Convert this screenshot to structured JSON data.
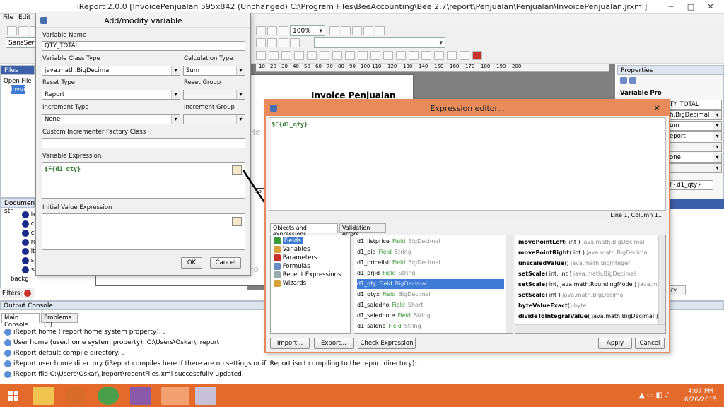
{
  "main_window": {
    "title": "iReport 2.0.0  [InvoicePenjualan 595x842 (Unchanged) C:\\Program Files\\BeeAccounting\\Bee 2.7\\report\\Penjualan\\Penjualan\\InvoicePenjualan.jrxml]",
    "menu": [
      "File",
      "Edit",
      "V"
    ],
    "font_combo": "SansSerif",
    "zoom": "100%"
  },
  "files_panel": {
    "title": "Files",
    "items": [
      "Open File",
      "Invoi"
    ]
  },
  "document_structure": {
    "title": "Document str",
    "items": [
      "te",
      "cr",
      "cr",
      "re",
      "itr",
      "sy",
      "sa"
    ],
    "footer": "backg",
    "filters_label": "Filters:"
  },
  "properties_panel": {
    "title": "Properties",
    "header": "Variable Pro",
    "values": [
      "TY_TOTAL",
      "h.BigDecimal",
      "um",
      "eport",
      "one",
      "F{d1_qty}"
    ],
    "library": "ary"
  },
  "output_console": {
    "title": "Output Console",
    "tabs": [
      "Main Console",
      "Problems (0)"
    ],
    "lines": [
      "iReport home (ireport.home system property): .",
      "User home (user.home system property): C:\\Users\\Oskar\\.ireport",
      "iReport default compile directory: .",
      "iReport user home directory (iReport compiles here if there are no settings or if iReport isn't compiling to the report directory): .",
      "iReport file C:\\Users\\Oskar\\.ireport\\recentFiles.xml successfully updated."
    ]
  },
  "report_canvas": {
    "title": "Invoice Penjualan",
    "ruler": [
      "10",
      "20",
      "30",
      "40",
      "50",
      "60",
      "70",
      "80",
      "90",
      "100",
      "110",
      "120",
      "130",
      "140",
      "150",
      "160",
      "170",
      "180",
      "190",
      "200"
    ],
    "side_text": [
      "He",
      "So",
      "Fo"
    ]
  },
  "variable_dialog": {
    "title": "Add/modify variable",
    "variable_name_label": "Variable Name",
    "variable_name": "QTY_TOTAL",
    "class_type_label": "Variable Class Type",
    "class_type": "java.math.BigDecimal",
    "calc_type_label": "Calculation Type",
    "calc_type": "Sum",
    "reset_type_label": "Reset Type",
    "reset_type": "Report",
    "reset_group_label": "Reset Group",
    "increment_type_label": "Increment Type",
    "increment_type": "None",
    "increment_group_label": "Increment Group",
    "factory_label": "Custom Incrementer Factory Class",
    "expression_label": "Variable Expression",
    "expression": "$F{d1_qty}",
    "initial_label": "Initial Value Expression",
    "ok": "OK",
    "cancel": "Cancel"
  },
  "expression_editor": {
    "title": "Expression editor...",
    "expression": "$F{d1_qty}",
    "position": "Line 1, Column 11",
    "tabs": [
      "Objects and expressions",
      "Validation errors"
    ],
    "categories": [
      "Fields",
      "Variables",
      "Parameters",
      "Formulas",
      "Recent Expressions",
      "Wizards"
    ],
    "fields": [
      {
        "name": "d1_listprice",
        "kind": "Field",
        "type": "BigDecimal"
      },
      {
        "name": "d1_pid",
        "kind": "Field",
        "type": "String"
      },
      {
        "name": "d1_pricelist",
        "kind": "Field",
        "type": "BigDecimal"
      },
      {
        "name": "d1_prjid",
        "kind": "Field",
        "type": "String"
      },
      {
        "name": "d1_qty",
        "kind": "Field",
        "type": "BigDecimal"
      },
      {
        "name": "d1_qtyx",
        "kind": "Field",
        "type": "BigDecimal"
      },
      {
        "name": "d1_saledno",
        "kind": "Field",
        "type": "Short"
      },
      {
        "name": "d1_salednote",
        "kind": "Field",
        "type": "String"
      },
      {
        "name": "d1_saleno",
        "kind": "Field",
        "type": "String"
      }
    ],
    "methods": [
      {
        "name": "movePointLeft",
        "args": "( int )",
        "ret": "java.math.BigDecimal"
      },
      {
        "name": "movePointRight",
        "args": "( int )",
        "ret": "java.math.BigDecimal"
      },
      {
        "name": "unscaledValue",
        "args": "()",
        "ret": "java.math.BigInteger"
      },
      {
        "name": "setScale",
        "args": "( int, int )",
        "ret": "java.math.BigDecimal"
      },
      {
        "name": "setScale",
        "args": "( int, java.math.RoundingMode )",
        "ret": "java.math."
      },
      {
        "name": "setScale",
        "args": "( int )",
        "ret": "java.math.BigDecimal"
      },
      {
        "name": "byteValueExact",
        "args": "()",
        "ret": "byte"
      },
      {
        "name": "divideToIntegralValue",
        "args": "( java.math.BigDecimal )",
        "ret": "jav"
      }
    ],
    "import": "Import...",
    "export": "Export...",
    "check": "Check Expression",
    "apply": "Apply",
    "cancel": "Cancel"
  },
  "taskbar": {
    "time": "4:07 PM",
    "date": "6/26/2015"
  },
  "colors": {
    "taskbar": "#e46a2c",
    "expr_titlebar": "#e98a5a",
    "selection": "#3d7bd6",
    "code_green": "#2d7a2d"
  }
}
